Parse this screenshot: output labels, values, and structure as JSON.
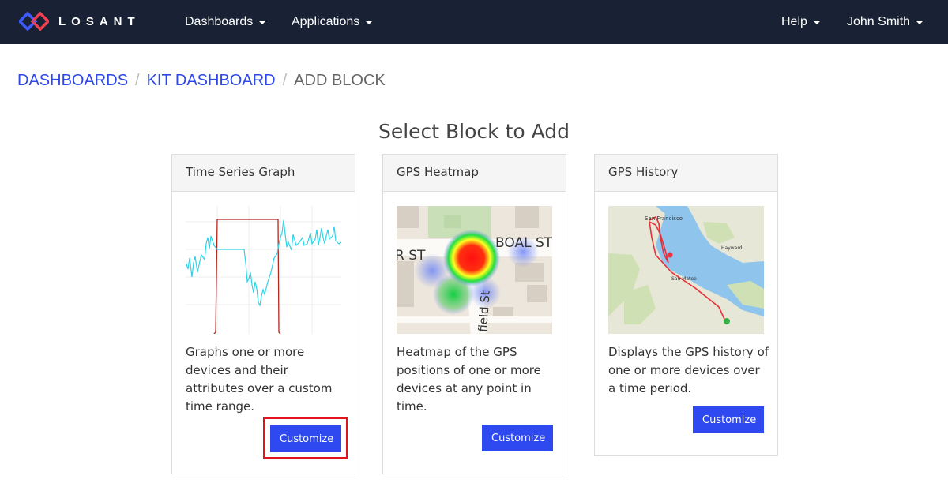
{
  "navbar": {
    "brand": "LOSANT",
    "menus": [
      {
        "label": "Dashboards"
      },
      {
        "label": "Applications"
      },
      {
        "label": "Help"
      },
      {
        "label": "John Smith"
      }
    ]
  },
  "breadcrumb": {
    "items": [
      "DASHBOARDS",
      "KIT DASHBOARD"
    ],
    "separator": "/",
    "current": "ADD BLOCK"
  },
  "page": {
    "heading": "Select Block to Add"
  },
  "cards": [
    {
      "title": "Time Series Graph",
      "description": "Graphs one or more devices and their attributes over a custom time range.",
      "button": "Customize",
      "highlighted": true
    },
    {
      "title": "GPS Heatmap",
      "description": "Heatmap of the GPS positions of one or more devices at any point in time.",
      "button": "Customize",
      "map_labels": {
        "street1": "BOAL ST",
        "street2": "R ST",
        "street3": "field St"
      }
    },
    {
      "title": "GPS History",
      "description": "Displays the GPS history of one or more devices over a time period.",
      "button": "Customize",
      "map_labels": {
        "city1": "San Francisco",
        "city2": "Hayward",
        "city3": "San Mateo"
      }
    }
  ],
  "colors": {
    "navbar_bg": "#182234",
    "accent": "#2f49f0",
    "link": "#2e48e8",
    "highlight": "#e0141c"
  }
}
